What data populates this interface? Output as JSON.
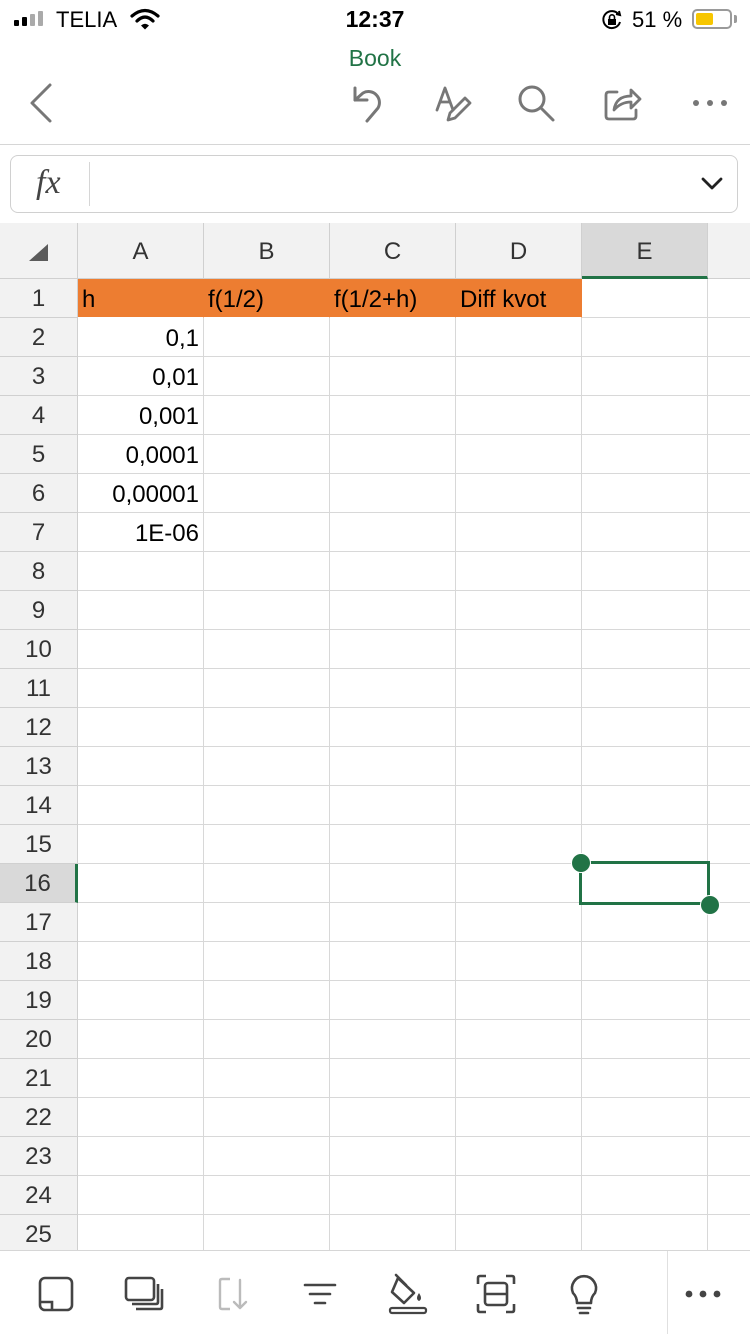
{
  "status_bar": {
    "carrier": "TELIA",
    "time": "12:37",
    "battery_percent": "51 %",
    "battery_level": 0.51,
    "icons": [
      "signal-icon",
      "wifi-icon",
      "orientation-lock-icon",
      "battery-icon"
    ]
  },
  "header": {
    "title": "Book",
    "icons": [
      "back-icon",
      "undo-icon",
      "edit-format-icon",
      "search-icon",
      "share-icon",
      "more-icon"
    ]
  },
  "formula_bar": {
    "label": "fx",
    "value": "",
    "icons": [
      "expand-chevron-icon"
    ]
  },
  "sheet": {
    "columns": [
      "A",
      "B",
      "C",
      "D",
      "E"
    ],
    "selected_column": "E",
    "rows": [
      "1",
      "2",
      "3",
      "4",
      "5",
      "6",
      "7",
      "8",
      "9",
      "10",
      "11",
      "12",
      "13",
      "14",
      "15",
      "16",
      "17",
      "18",
      "19",
      "20",
      "21",
      "22",
      "23",
      "24",
      "25"
    ],
    "selected_row": "16",
    "selected_cell": "E16",
    "header_fill_color": "#ED7D31",
    "accent_color": "#217346",
    "cells": {
      "A1": "h",
      "B1": "f(1/2)",
      "C1": "f(1/2+h)",
      "D1": "Diff kvot",
      "A2": "0,1",
      "A3": "0,01",
      "A4": "0,001",
      "A5": "0,0001",
      "A6": "0,00001",
      "A7": "1E-06"
    }
  },
  "bottom_toolbar": {
    "icons": [
      "sheet-view-icon",
      "sheets-icon",
      "sort-icon",
      "filter-icon",
      "fill-color-icon",
      "card-view-icon",
      "ideas-icon",
      "more-icon"
    ]
  }
}
